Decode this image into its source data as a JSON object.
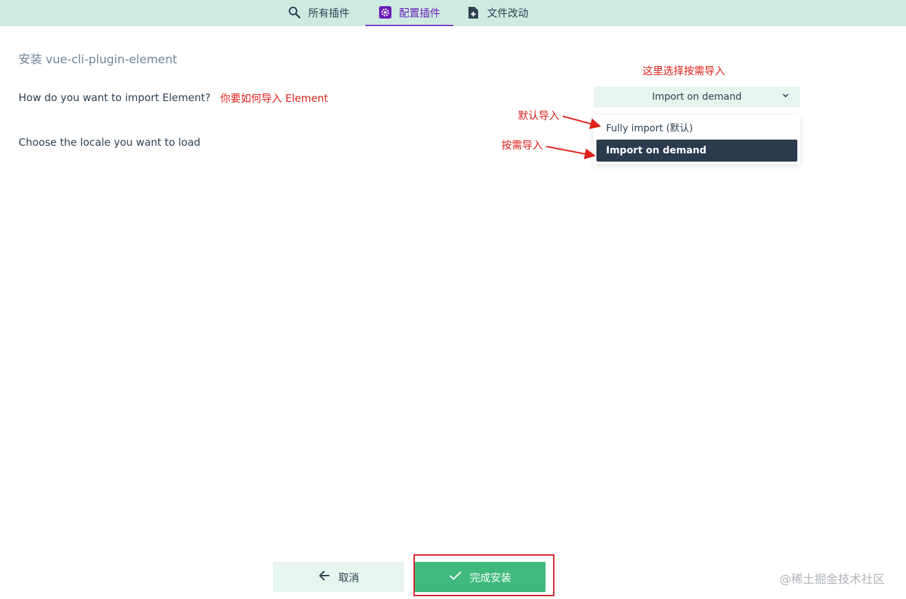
{
  "tabs": [
    {
      "label": "所有插件",
      "icon": "search-icon",
      "active": false
    },
    {
      "label": "配置插件",
      "icon": "gear-icon",
      "active": true
    },
    {
      "label": "文件改动",
      "icon": "file-add-icon",
      "active": false
    }
  ],
  "page": {
    "title": "安装 vue-cli-plugin-element"
  },
  "prompts": {
    "import_question": "How do you want to import Element?",
    "locale_question": "Choose the locale you want to load"
  },
  "select": {
    "value": "Import on demand",
    "options": [
      "Fully import (默认)",
      "Import on demand"
    ]
  },
  "annotations": {
    "q1": "你要如何导入 Element",
    "top": "这里选择按需导入",
    "default": "默认导入",
    "demand": "按需导入"
  },
  "buttons": {
    "cancel": "取消",
    "finish": "完成安装"
  },
  "watermark": "@稀土掘金技术社区",
  "colors": {
    "topbar": "#cdebe0",
    "accent": "#7b3fc9",
    "primary": "#3fb97d",
    "annotation": "#e0201a",
    "selected_option": "#2c3a4e"
  }
}
